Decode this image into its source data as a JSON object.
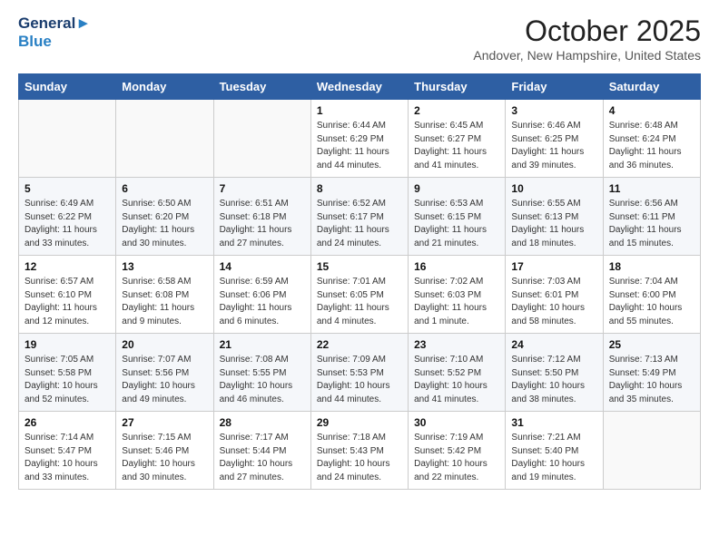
{
  "header": {
    "logo_line1": "General",
    "logo_line2": "Blue",
    "month": "October 2025",
    "location": "Andover, New Hampshire, United States"
  },
  "weekdays": [
    "Sunday",
    "Monday",
    "Tuesday",
    "Wednesday",
    "Thursday",
    "Friday",
    "Saturday"
  ],
  "weeks": [
    [
      {
        "day": "",
        "info": ""
      },
      {
        "day": "",
        "info": ""
      },
      {
        "day": "",
        "info": ""
      },
      {
        "day": "1",
        "info": "Sunrise: 6:44 AM\nSunset: 6:29 PM\nDaylight: 11 hours\nand 44 minutes."
      },
      {
        "day": "2",
        "info": "Sunrise: 6:45 AM\nSunset: 6:27 PM\nDaylight: 11 hours\nand 41 minutes."
      },
      {
        "day": "3",
        "info": "Sunrise: 6:46 AM\nSunset: 6:25 PM\nDaylight: 11 hours\nand 39 minutes."
      },
      {
        "day": "4",
        "info": "Sunrise: 6:48 AM\nSunset: 6:24 PM\nDaylight: 11 hours\nand 36 minutes."
      }
    ],
    [
      {
        "day": "5",
        "info": "Sunrise: 6:49 AM\nSunset: 6:22 PM\nDaylight: 11 hours\nand 33 minutes."
      },
      {
        "day": "6",
        "info": "Sunrise: 6:50 AM\nSunset: 6:20 PM\nDaylight: 11 hours\nand 30 minutes."
      },
      {
        "day": "7",
        "info": "Sunrise: 6:51 AM\nSunset: 6:18 PM\nDaylight: 11 hours\nand 27 minutes."
      },
      {
        "day": "8",
        "info": "Sunrise: 6:52 AM\nSunset: 6:17 PM\nDaylight: 11 hours\nand 24 minutes."
      },
      {
        "day": "9",
        "info": "Sunrise: 6:53 AM\nSunset: 6:15 PM\nDaylight: 11 hours\nand 21 minutes."
      },
      {
        "day": "10",
        "info": "Sunrise: 6:55 AM\nSunset: 6:13 PM\nDaylight: 11 hours\nand 18 minutes."
      },
      {
        "day": "11",
        "info": "Sunrise: 6:56 AM\nSunset: 6:11 PM\nDaylight: 11 hours\nand 15 minutes."
      }
    ],
    [
      {
        "day": "12",
        "info": "Sunrise: 6:57 AM\nSunset: 6:10 PM\nDaylight: 11 hours\nand 12 minutes."
      },
      {
        "day": "13",
        "info": "Sunrise: 6:58 AM\nSunset: 6:08 PM\nDaylight: 11 hours\nand 9 minutes."
      },
      {
        "day": "14",
        "info": "Sunrise: 6:59 AM\nSunset: 6:06 PM\nDaylight: 11 hours\nand 6 minutes."
      },
      {
        "day": "15",
        "info": "Sunrise: 7:01 AM\nSunset: 6:05 PM\nDaylight: 11 hours\nand 4 minutes."
      },
      {
        "day": "16",
        "info": "Sunrise: 7:02 AM\nSunset: 6:03 PM\nDaylight: 11 hours\nand 1 minute."
      },
      {
        "day": "17",
        "info": "Sunrise: 7:03 AM\nSunset: 6:01 PM\nDaylight: 10 hours\nand 58 minutes."
      },
      {
        "day": "18",
        "info": "Sunrise: 7:04 AM\nSunset: 6:00 PM\nDaylight: 10 hours\nand 55 minutes."
      }
    ],
    [
      {
        "day": "19",
        "info": "Sunrise: 7:05 AM\nSunset: 5:58 PM\nDaylight: 10 hours\nand 52 minutes."
      },
      {
        "day": "20",
        "info": "Sunrise: 7:07 AM\nSunset: 5:56 PM\nDaylight: 10 hours\nand 49 minutes."
      },
      {
        "day": "21",
        "info": "Sunrise: 7:08 AM\nSunset: 5:55 PM\nDaylight: 10 hours\nand 46 minutes."
      },
      {
        "day": "22",
        "info": "Sunrise: 7:09 AM\nSunset: 5:53 PM\nDaylight: 10 hours\nand 44 minutes."
      },
      {
        "day": "23",
        "info": "Sunrise: 7:10 AM\nSunset: 5:52 PM\nDaylight: 10 hours\nand 41 minutes."
      },
      {
        "day": "24",
        "info": "Sunrise: 7:12 AM\nSunset: 5:50 PM\nDaylight: 10 hours\nand 38 minutes."
      },
      {
        "day": "25",
        "info": "Sunrise: 7:13 AM\nSunset: 5:49 PM\nDaylight: 10 hours\nand 35 minutes."
      }
    ],
    [
      {
        "day": "26",
        "info": "Sunrise: 7:14 AM\nSunset: 5:47 PM\nDaylight: 10 hours\nand 33 minutes."
      },
      {
        "day": "27",
        "info": "Sunrise: 7:15 AM\nSunset: 5:46 PM\nDaylight: 10 hours\nand 30 minutes."
      },
      {
        "day": "28",
        "info": "Sunrise: 7:17 AM\nSunset: 5:44 PM\nDaylight: 10 hours\nand 27 minutes."
      },
      {
        "day": "29",
        "info": "Sunrise: 7:18 AM\nSunset: 5:43 PM\nDaylight: 10 hours\nand 24 minutes."
      },
      {
        "day": "30",
        "info": "Sunrise: 7:19 AM\nSunset: 5:42 PM\nDaylight: 10 hours\nand 22 minutes."
      },
      {
        "day": "31",
        "info": "Sunrise: 7:21 AM\nSunset: 5:40 PM\nDaylight: 10 hours\nand 19 minutes."
      },
      {
        "day": "",
        "info": ""
      }
    ]
  ]
}
